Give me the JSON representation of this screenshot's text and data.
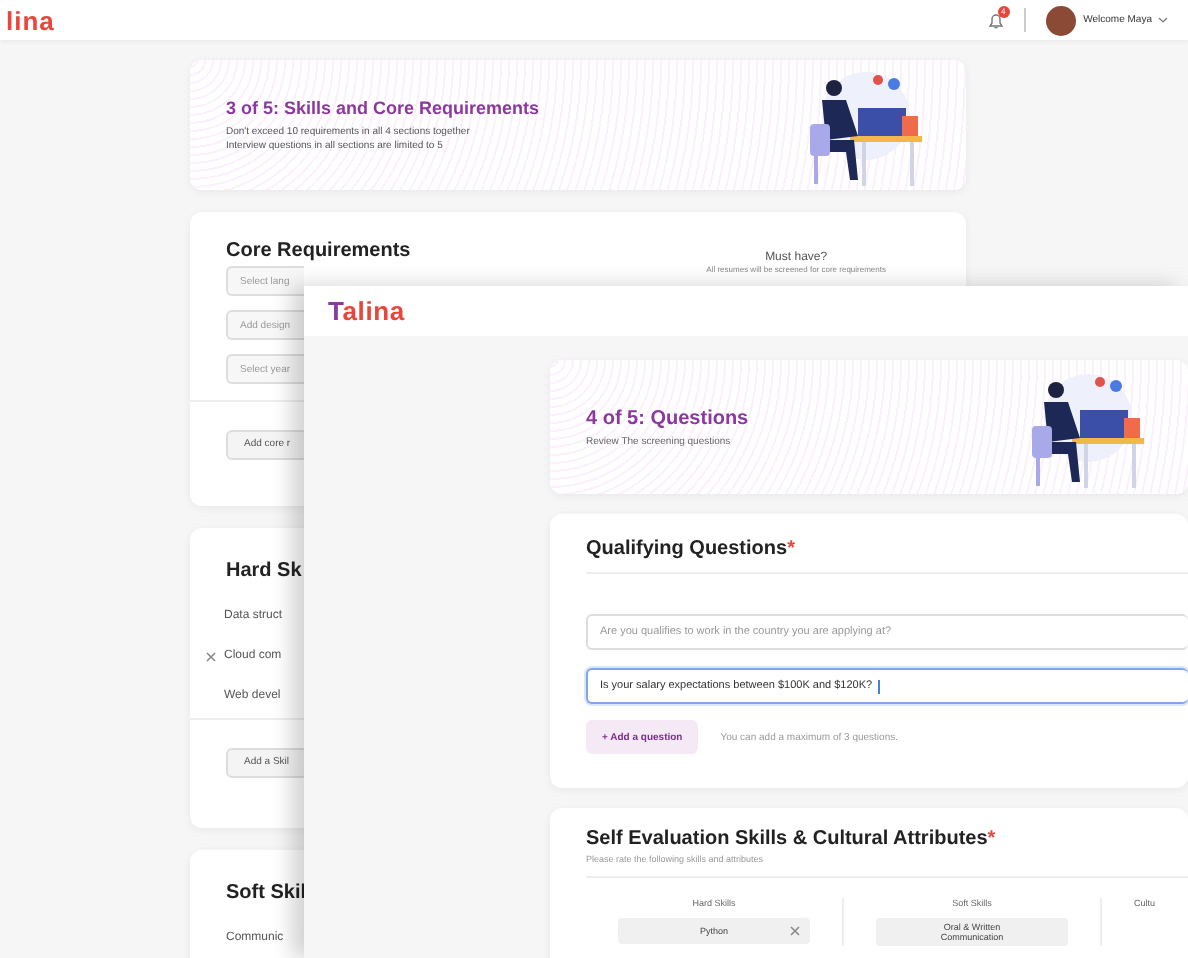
{
  "back_window": {
    "logo": "lina",
    "notification_count": "4",
    "user_greeting": "Welcome Maya",
    "step_header": {
      "title": "3 of 5: Skills and Core Requirements",
      "lines": [
        "Don't exceed 10 requirements in all 4 sections together",
        "Interview questions in all sections are limited to 5"
      ]
    },
    "core_requirements": {
      "title": "Core Requirements",
      "column_heading": "Must have?",
      "column_note": "All resumes will be screened for core requirements",
      "fields": [
        {
          "placeholder": "Select lang"
        },
        {
          "placeholder": "Add design"
        },
        {
          "placeholder": "Select year"
        }
      ],
      "add_button": "Add core r"
    },
    "hard_skills": {
      "title": "Hard Sk",
      "items": [
        {
          "label": "Data struct",
          "removable": false
        },
        {
          "label": "Cloud com",
          "removable": true
        },
        {
          "label": "Web devel",
          "removable": false
        }
      ],
      "add_button": "Add a Skil"
    },
    "soft_skills": {
      "title": "Soft Skil",
      "items": [
        "Communic"
      ]
    }
  },
  "front_window": {
    "logo": "Talina",
    "step_header": {
      "title": "4 of 5: Questions",
      "subtitle": "Review The screening questions"
    },
    "qualifying": {
      "title": "Qualifying Questions",
      "required_mark": "*",
      "questions": [
        {
          "placeholder": "Are you qualifies to work in the country you are applying at?",
          "focused": false
        },
        {
          "value": "Is your salary expectations between $100K and $120K?",
          "focused": true
        }
      ],
      "add_button": "+ Add a question",
      "hint": "You can add a maximum of 3 questions."
    },
    "self_evaluation": {
      "title": "Self Evaluation Skills & Cultural Attributes",
      "required_mark": "*",
      "subtitle": "Please rate the following skills and attributes",
      "columns": [
        {
          "heading": "Hard Skills",
          "items": [
            {
              "label": "Python",
              "removable": true
            }
          ]
        },
        {
          "heading": "Soft Skills",
          "items": [
            {
              "label": "Oral & Written Communication",
              "removable": false
            }
          ]
        },
        {
          "heading": "Cultu"
        }
      ]
    }
  }
}
